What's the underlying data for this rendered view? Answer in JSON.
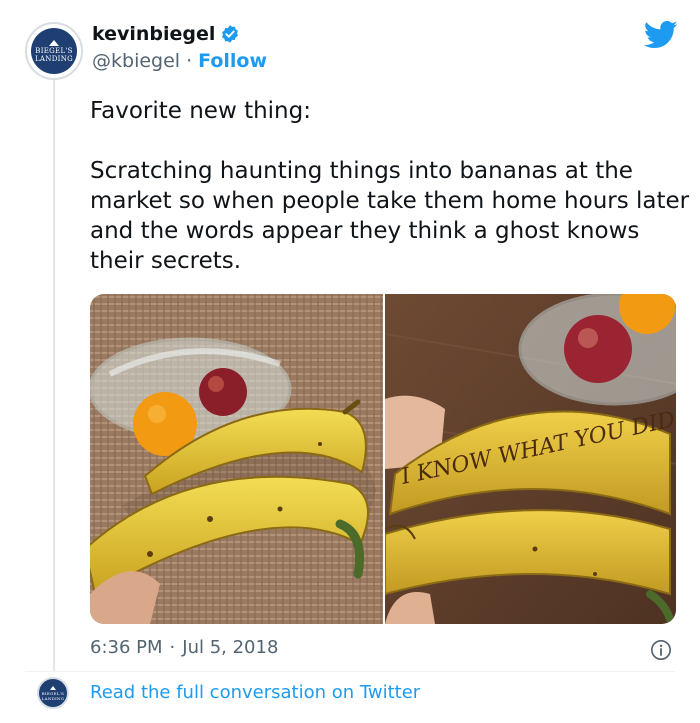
{
  "author": {
    "name": "kevinbiegel",
    "handle": "@kbiegel",
    "separator": "·",
    "follow_label": "Follow",
    "avatar_lines": [
      "BIEGEL'S",
      "LANDING"
    ]
  },
  "tweet": {
    "paragraphs": [
      "Favorite new thing:",
      "Scratching haunting things into bananas at the market so when people take them home hours later and the words appear they think a ghost knows their secrets."
    ],
    "photo_text": "I KNOW WHAT YOU DID"
  },
  "meta": {
    "time": "6:36 PM",
    "separator": "·",
    "date": "Jul 5, 2018"
  },
  "footer": {
    "read_more": "Read the full conversation on Twitter"
  },
  "icons": {
    "verified": "verified-badge-icon",
    "brand": "twitter-bird-icon",
    "info": "info-icon"
  },
  "colors": {
    "accent": "#1d9bf0",
    "text": "#0f1419",
    "muted": "#536471",
    "avatar_bg": "#1f3f73"
  }
}
